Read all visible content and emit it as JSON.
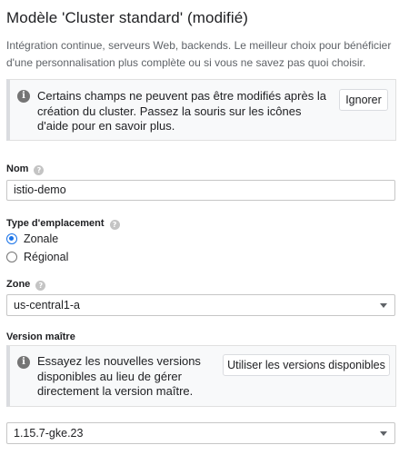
{
  "header": {
    "title": "Modèle 'Cluster standard' (modifié)",
    "description": "Intégration continue, serveurs Web, backends. Le meilleur choix pour bénéficier d'une personnalisation plus complète ou si vous ne savez pas quoi choisir."
  },
  "notice": {
    "text": "Certains champs ne peuvent pas être modifiés après la création du cluster. Passez la souris sur les icônes d'aide pour en savoir plus.",
    "dismiss_label": "Ignorer"
  },
  "name_field": {
    "label": "Nom",
    "value": "istio-demo"
  },
  "location_type": {
    "label": "Type d'emplacement",
    "options": [
      {
        "label": "Zonale",
        "selected": true
      },
      {
        "label": "Régional",
        "selected": false
      }
    ]
  },
  "zone": {
    "label": "Zone",
    "value": "us-central1-a"
  },
  "master_version": {
    "label": "Version maître",
    "notice_text": "Essayez les nouvelles versions disponibles au lieu de gérer directement la version maître.",
    "use_available_label": "Utiliser les versions disponibles",
    "value": "1.15.7-gke.23"
  },
  "colors": {
    "accent": "#1a73e8",
    "notice_bg": "#f8f9fa"
  }
}
